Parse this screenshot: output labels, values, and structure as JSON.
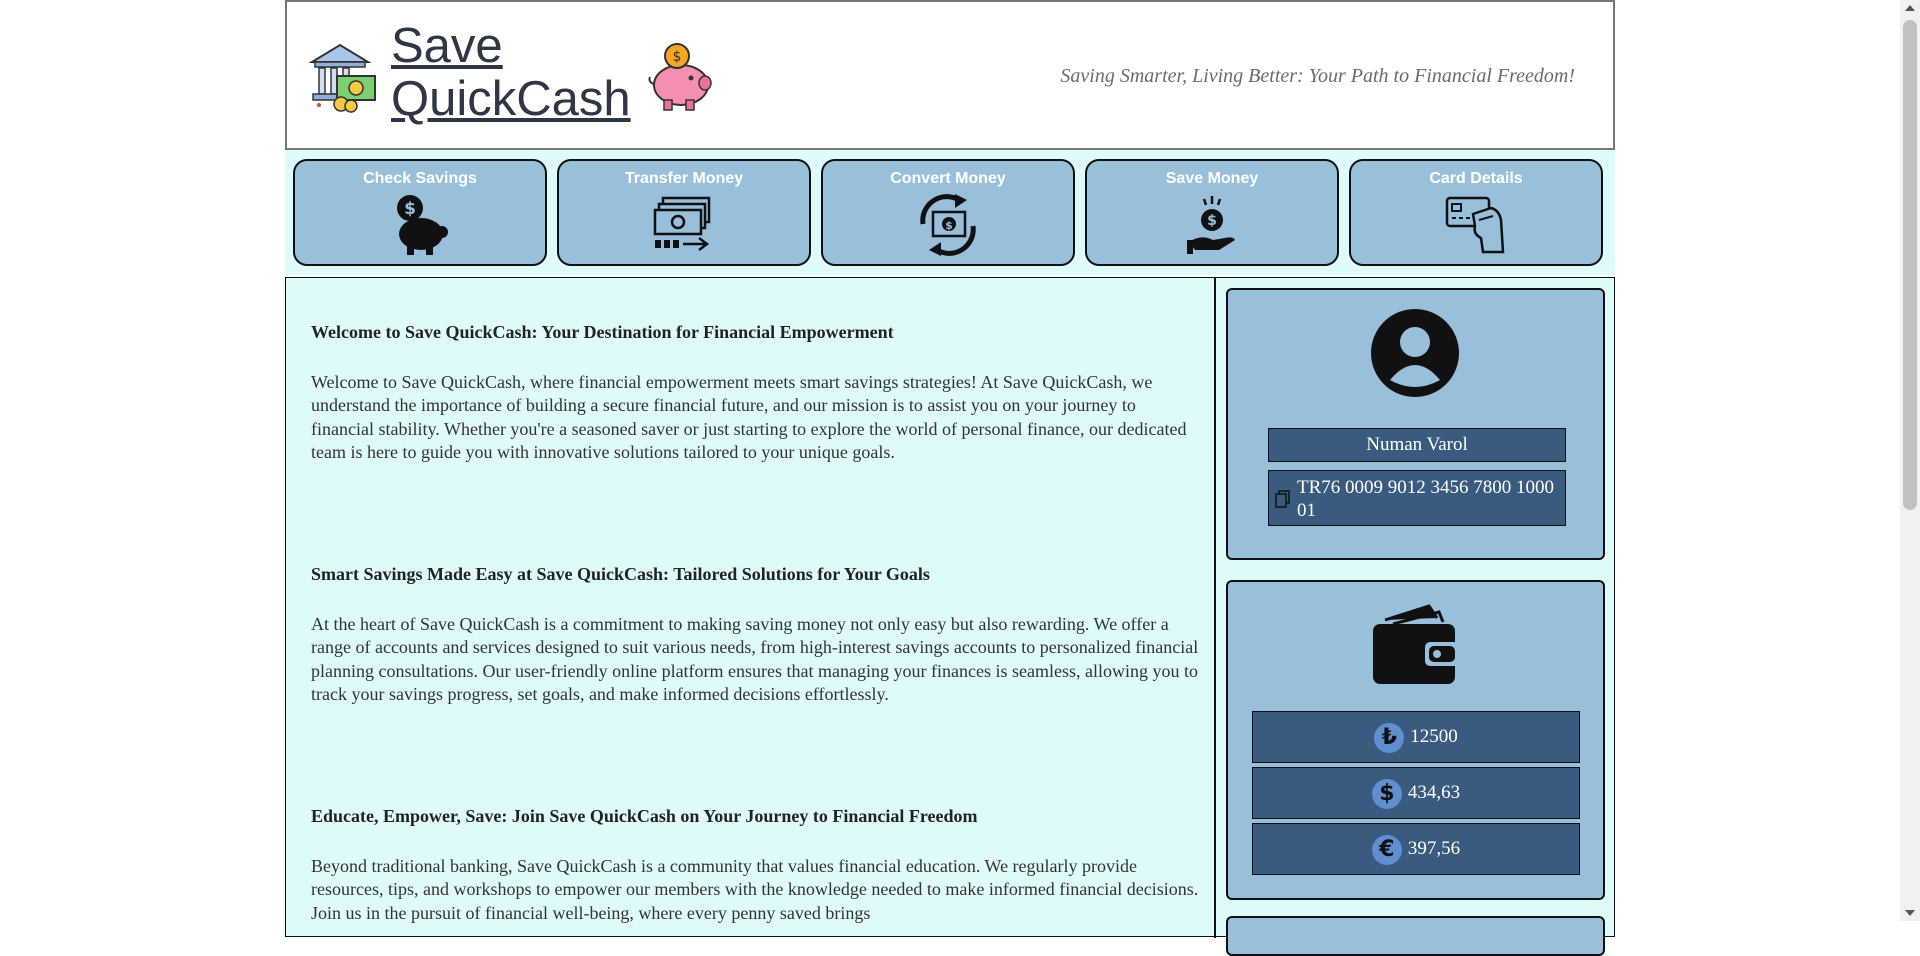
{
  "header": {
    "brand_line1": "Save",
    "brand_line2": "QuickCash",
    "slogan": "Saving Smarter, Living Better: Your Path to Financial Freedom!"
  },
  "nav": {
    "items": [
      {
        "label": "Check Savings",
        "icon": "piggy-bank-dollar-icon"
      },
      {
        "label": "Transfer Money",
        "icon": "money-transfer-icon"
      },
      {
        "label": "Convert Money",
        "icon": "currency-exchange-icon"
      },
      {
        "label": "Save Money",
        "icon": "hand-coin-icon"
      },
      {
        "label": "Card Details",
        "icon": "credit-card-hand-icon"
      }
    ]
  },
  "article": {
    "sections": [
      {
        "title": "Welcome to Save QuickCash: Your Destination for Financial Empowerment",
        "body": "Welcome to Save QuickCash, where financial empowerment meets smart savings strategies! At Save QuickCash, we understand the importance of building a secure financial future, and our mission is to assist you on your journey to financial stability. Whether you're a seasoned saver or just starting to explore the world of personal finance, our dedicated team is here to guide you with innovative solutions tailored to your unique goals."
      },
      {
        "title": "Smart Savings Made Easy at Save QuickCash: Tailored Solutions for Your Goals",
        "body": "At the heart of Save QuickCash is a commitment to making saving money not only easy but also rewarding. We offer a range of accounts and services designed to suit various needs, from high-interest savings accounts to personalized financial planning consultations. Our user-friendly online platform ensures that managing your finances is seamless, allowing you to track your savings progress, set goals, and make informed decisions effortlessly."
      },
      {
        "title": "Educate, Empower, Save: Join Save QuickCash on Your Journey to Financial Freedom",
        "body": "Beyond traditional banking, Save QuickCash is a community that values financial education. We regularly provide resources, tips, and workshops to empower our members with the knowledge needed to make informed financial decisions. Join us in the pursuit of financial well-being, where every penny saved brings"
      }
    ]
  },
  "profile": {
    "name": "Numan Varol",
    "iban": "TR76 0009 9012 3456 7800 1000 01"
  },
  "wallet": {
    "balances": [
      {
        "symbol": "₺",
        "amount": "12500"
      },
      {
        "symbol": "$",
        "amount": "434,63"
      },
      {
        "symbol": "€",
        "amount": "397,56"
      }
    ]
  },
  "colors": {
    "nav_bg": "#98c0da",
    "panel_bg": "#dffafb",
    "pill_bg": "#3a5b80"
  }
}
